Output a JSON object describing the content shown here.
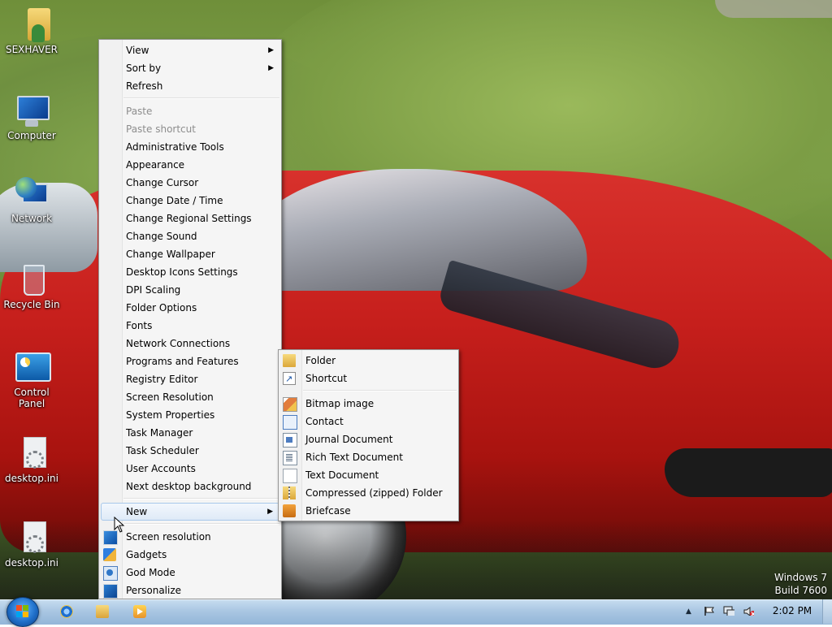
{
  "desktop": {
    "icons": [
      {
        "label": "SEXHAVER",
        "icon": "user-folder-icon"
      },
      {
        "label": "Computer",
        "icon": "computer-icon"
      },
      {
        "label": "Network",
        "icon": "network-icon"
      },
      {
        "label": "Recycle Bin",
        "icon": "recycle-bin-icon"
      },
      {
        "label": "Control Panel",
        "icon": "control-panel-icon"
      },
      {
        "label": "desktop.ini",
        "icon": "settings-file-icon"
      },
      {
        "label": "desktop.ini",
        "icon": "settings-file-icon"
      }
    ],
    "watermark": {
      "line1": "Windows 7",
      "line2": "Build 7600"
    }
  },
  "context_menu": {
    "view": "View",
    "sort_by": "Sort by",
    "refresh": "Refresh",
    "paste": "Paste",
    "paste_shortcut": "Paste shortcut",
    "tools": [
      "Administrative Tools",
      "Appearance",
      "Change Cursor",
      "Change Date / Time",
      "Change Regional Settings",
      "Change Sound",
      "Change Wallpaper",
      "Desktop Icons Settings",
      "DPI Scaling",
      "Folder Options",
      "Fonts",
      "Network Connections",
      "Programs and Features",
      "Registry Editor",
      "Screen Resolution",
      "System Properties",
      "Task Manager",
      "Task Scheduler",
      "User Accounts",
      "Next desktop background"
    ],
    "new": "New",
    "screen_resolution": "Screen resolution",
    "gadgets": "Gadgets",
    "god_mode": "God Mode",
    "personalize": "Personalize"
  },
  "new_submenu": {
    "folder": "Folder",
    "shortcut": "Shortcut",
    "bitmap": "Bitmap image",
    "contact": "Contact",
    "journal": "Journal Document",
    "rtf": "Rich Text Document",
    "text": "Text Document",
    "zip": "Compressed (zipped) Folder",
    "briefcase": "Briefcase"
  },
  "taskbar": {
    "pinned": [
      {
        "icon": "internet-explorer-icon"
      },
      {
        "icon": "windows-explorer-icon"
      },
      {
        "icon": "media-player-icon"
      }
    ],
    "clock": "2:02 PM",
    "tray_icons": [
      "show-hidden-icons-arrow-icon",
      "action-center-flag-icon",
      "network-tray-icon",
      "volume-muted-icon"
    ]
  }
}
